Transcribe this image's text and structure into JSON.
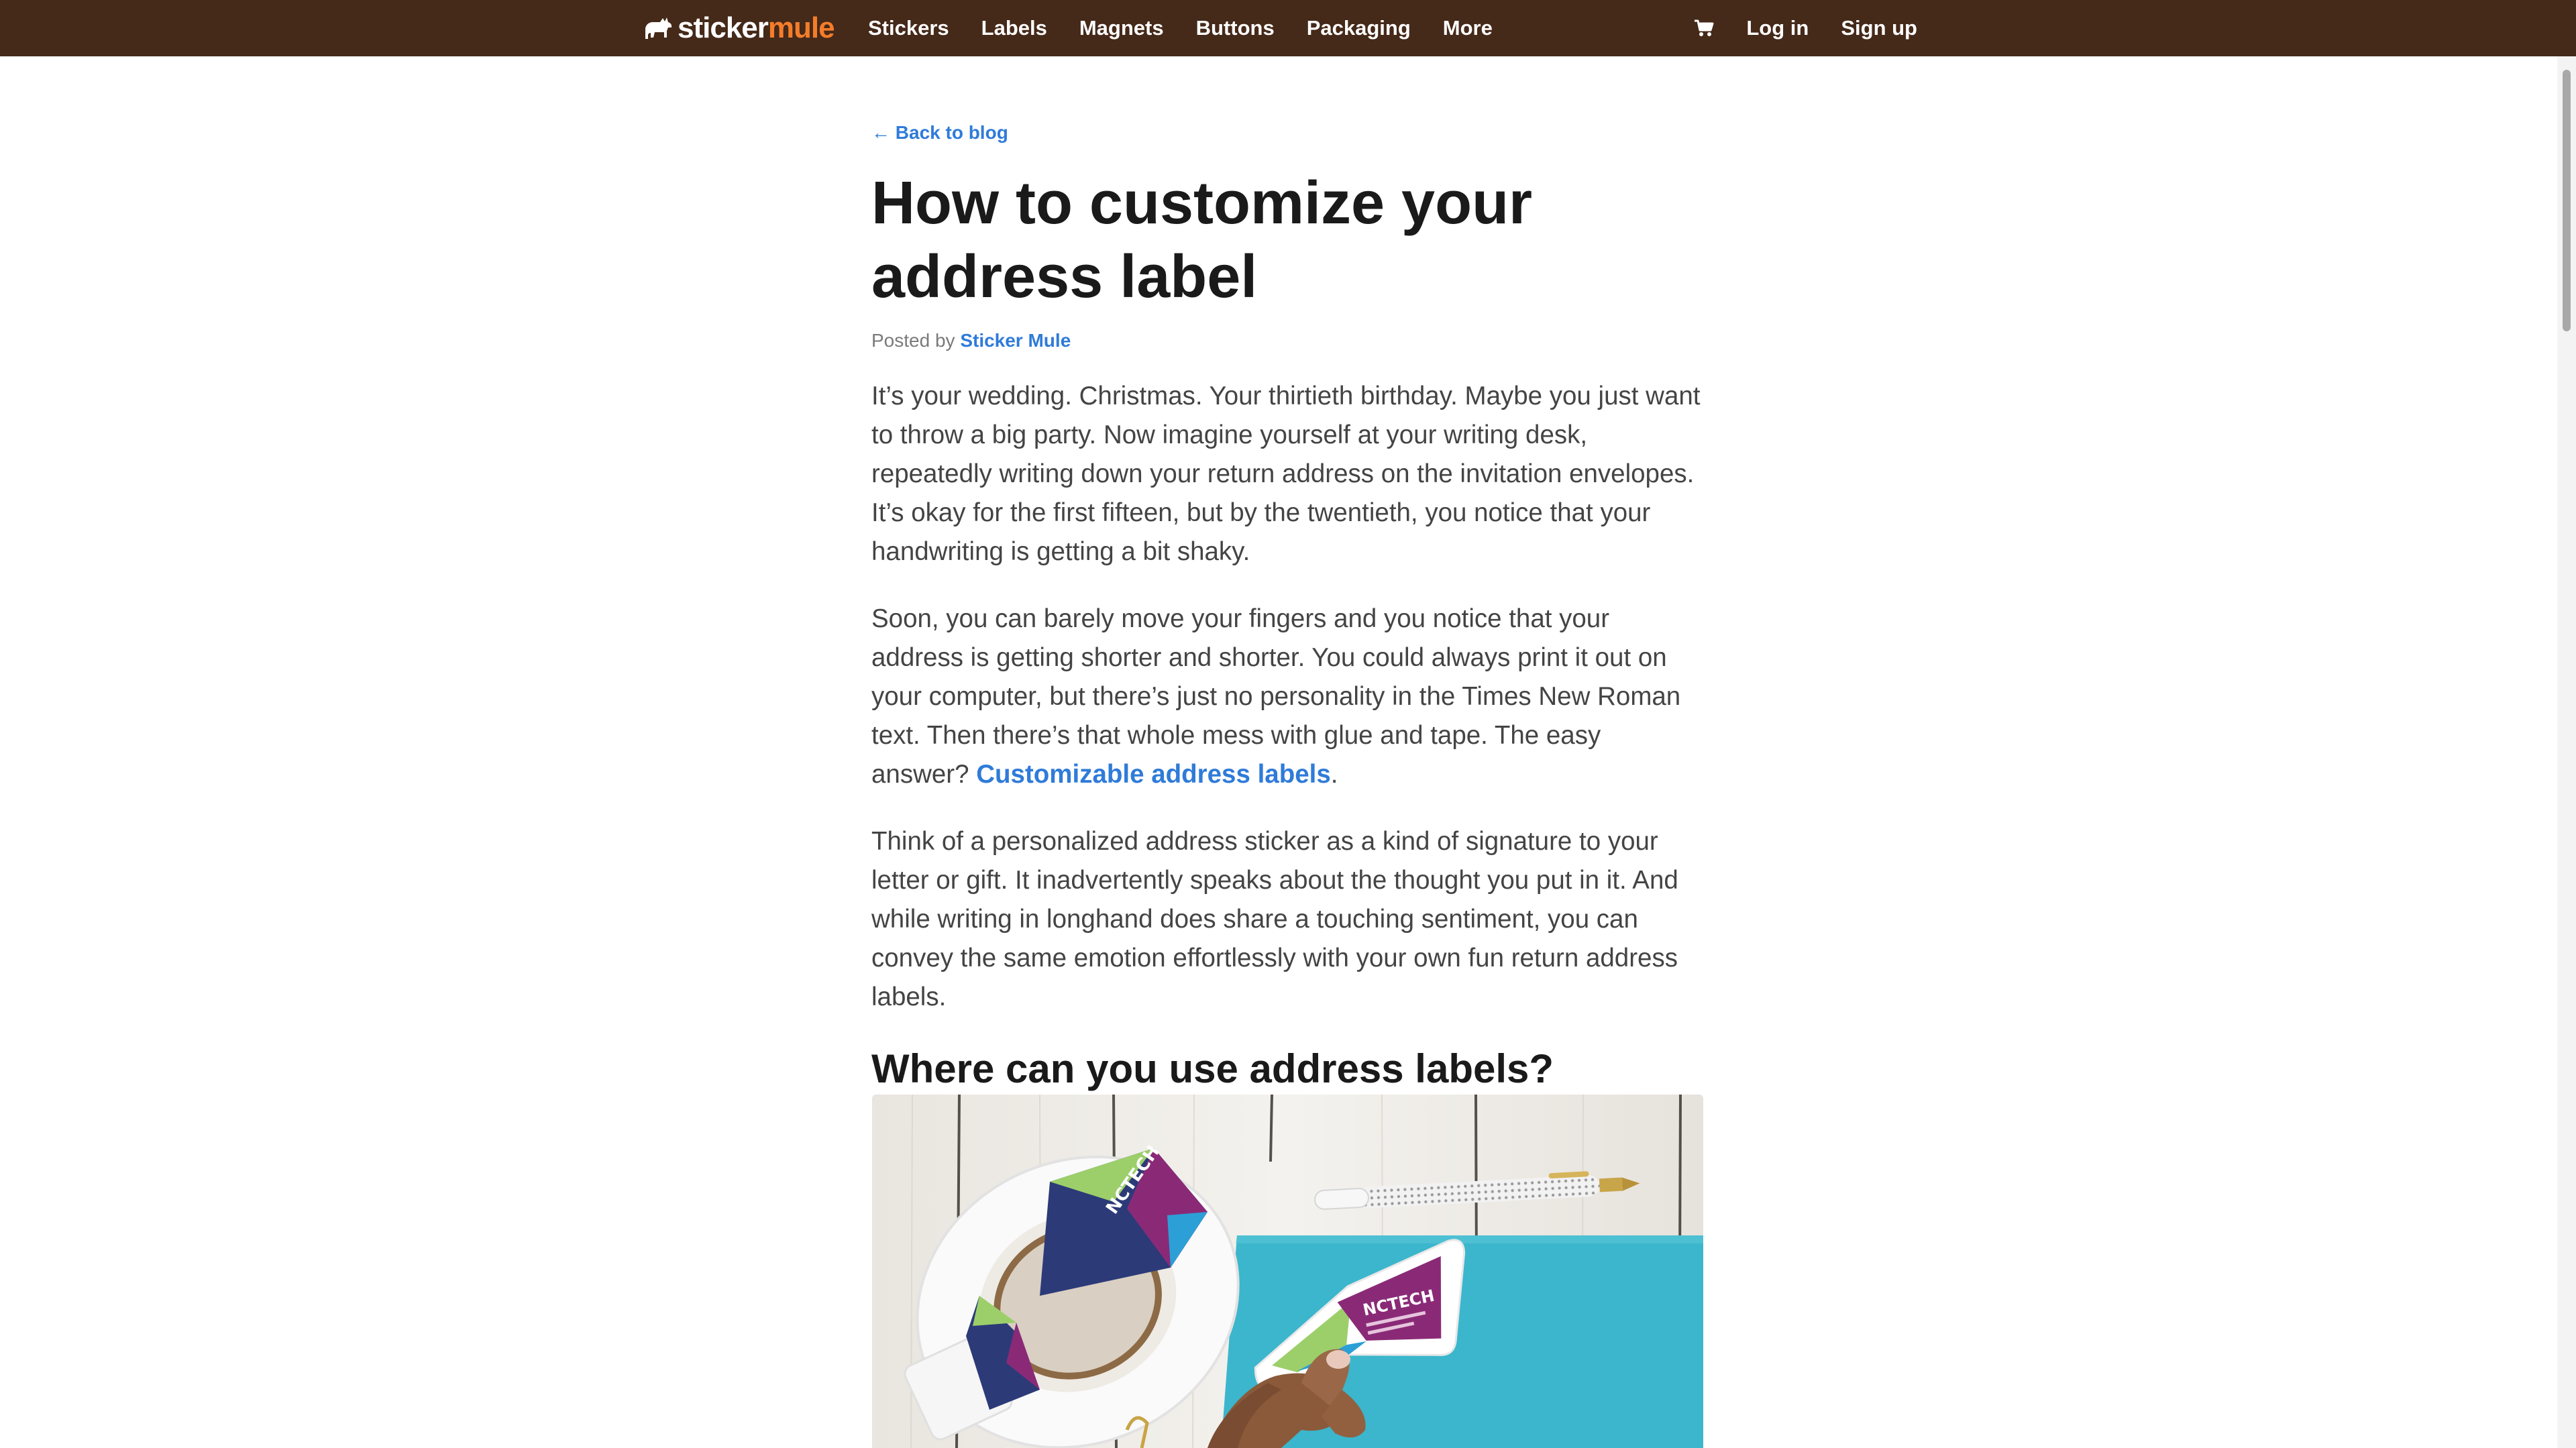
{
  "header": {
    "brand": {
      "wordmark_part1": "sticker",
      "wordmark_part2": "mule",
      "accent_color": "#f47d2a",
      "background_color": "#452919"
    },
    "nav_items": [
      "Stickers",
      "Labels",
      "Magnets",
      "Buttons",
      "Packaging",
      "More"
    ],
    "cart_icon": "cart-icon",
    "login_label": "Log in",
    "signup_label": "Sign up"
  },
  "article": {
    "back_link": "← Back to blog",
    "title": "How to customize your address label",
    "byline": {
      "prefix": "Posted by",
      "author": "Sticker Mule"
    },
    "paragraphs": [
      {
        "text": "It’s your wedding. Christmas. Your thirtieth birthday. Maybe you just want to throw a big party. Now imagine yourself at your writing desk, repeatedly writing down your return address on the invitation envelopes. It’s okay for the first fifteen, but by the twentieth, you notice that your handwriting is getting a bit shaky."
      },
      {
        "text": "Soon, you can barely move your fingers and you notice that your address is getting shorter and shorter. You could always print it out on your computer, but there’s just no personality in the Times New Roman text. Then there’s that whole mess with glue and tape. The easy answer?",
        "link_text": "Customizable address labels",
        "suffix": "."
      },
      {
        "text": "Think of a personalized address sticker as a kind of signature to your letter or gift. It inadvertently speaks about the thought you put in it. And while writing in longhand does share a touching sentiment, you can convey the same emotion effortlessly with your own fun return address labels."
      }
    ],
    "subheading": "Where can you use address labels?",
    "photo": {
      "label_text": "NCTECH",
      "colors": {
        "purple": "#8a2a77",
        "green": "#9ccf6a",
        "navy": "#2c3a78",
        "blue": "#2c9fd6",
        "teal_paper": "#3bb6cc",
        "wood": "#eeebe6"
      }
    }
  },
  "link_color": "#2f7bd9"
}
